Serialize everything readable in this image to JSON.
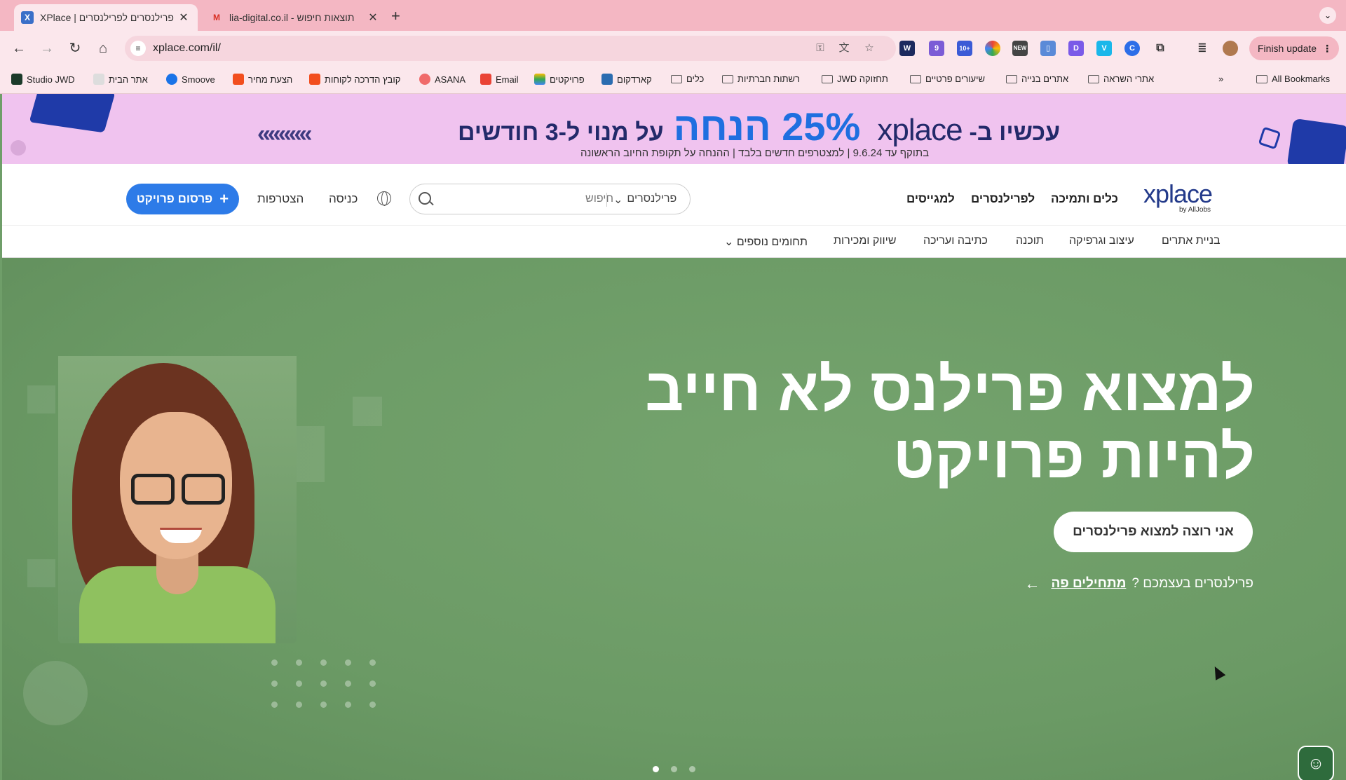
{
  "browser": {
    "tabs": [
      {
        "title": "XPlace | ות פרילנסרים לפרילנסרים",
        "favicon": "X",
        "active": true
      },
      {
        "title": "lia-digital.co.il - תוצאות חיפוש",
        "favicon": "M",
        "active": false
      }
    ],
    "url": "xplace.com/il/",
    "finish_update": "Finish update",
    "bookmarks": [
      {
        "label": "Studio JWD",
        "type": "site"
      },
      {
        "label": "אתר הבית",
        "type": "site"
      },
      {
        "label": "Smoove",
        "type": "site"
      },
      {
        "label": "הצעת מחיר",
        "type": "site"
      },
      {
        "label": "קובץ הדרכה לקוחות",
        "type": "site"
      },
      {
        "label": "ASANA",
        "type": "site"
      },
      {
        "label": "Email",
        "type": "site"
      },
      {
        "label": "פרויקטים",
        "type": "site"
      },
      {
        "label": "קארדקום",
        "type": "site"
      },
      {
        "label": "כלים",
        "type": "folder"
      },
      {
        "label": "רשתות חברתיות",
        "type": "folder"
      },
      {
        "label": "JWD תחזוקה",
        "type": "folder"
      },
      {
        "label": "שיעורים פרטיים",
        "type": "folder"
      },
      {
        "label": "אתרים בנייה",
        "type": "folder"
      },
      {
        "label": "אתרי השראה",
        "type": "folder"
      }
    ],
    "all_bookmarks": "All Bookmarks",
    "extension_badges": {
      "badge1": "9",
      "badge2": "10+"
    }
  },
  "promo": {
    "headline_prefix": "עכשיו ב-",
    "headline_brand": "xplace",
    "headline_discount": "25% הנחה",
    "headline_suffix": "על מנוי ל-3 חודשים",
    "subtext": "בתוקף עד 9.6.24 | למצטרפים חדשים בלבד | ההנחה על תקופת החיוב הראשונה",
    "arrows": "«««««"
  },
  "header": {
    "logo": "xplace",
    "logo_by": "by AllJobs",
    "nav": [
      "כלים ותמיכה",
      "לפרילנסרים",
      "למגייסים"
    ],
    "search_placeholder": "חיפוש",
    "search_category": "פרילנסרים",
    "login": "כניסה",
    "signup": "הצטרפות",
    "post_project": "פרסום פרויקט"
  },
  "categories": [
    "בניית אתרים",
    "עיצוב וגרפיקה",
    "תוכנה",
    "כתיבה ועריכה",
    "שיווק ומכירות",
    "תחומים נוספים"
  ],
  "hero": {
    "title_line1": "למצוא פרילנס לא חייב",
    "title_line2": "להיות פרויקט",
    "cta": "אני רוצה למצוא פרילנסרים",
    "sub_prefix": "פרילנסרים בעצמכם ?",
    "sub_link": "מתחילים פה"
  },
  "colors": {
    "accent_blue": "#2d7be8",
    "hero_green": "#6f9e69",
    "promo_bg": "#f0c3ef",
    "brand_navy": "#233a8a"
  }
}
